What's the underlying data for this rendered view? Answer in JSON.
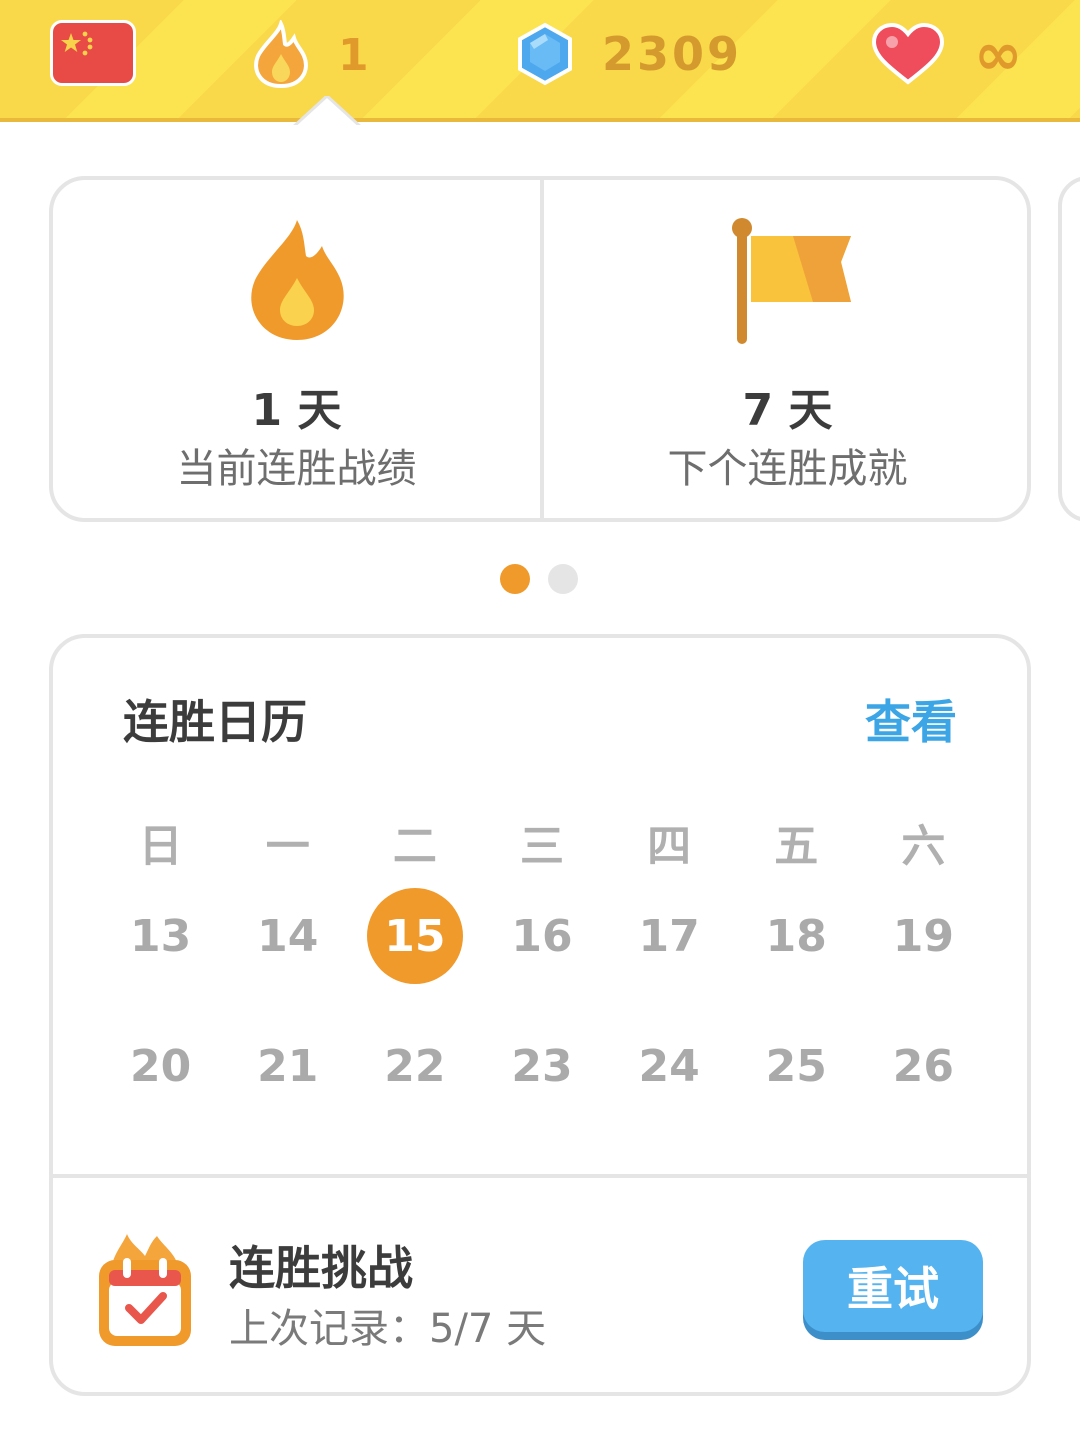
{
  "topbar": {
    "flag_label": "Chinese",
    "streak_count": "1",
    "gems": "2309",
    "hearts": "∞"
  },
  "stats": [
    {
      "icon": "fire-icon",
      "value": "1 天",
      "label": "当前连胜战绩"
    },
    {
      "icon": "flag-icon",
      "value": "7 天",
      "label": "下个连胜成就"
    }
  ],
  "carousel": {
    "page": 1,
    "pages": 2
  },
  "calendar": {
    "title": "连胜日历",
    "link": "查看",
    "weekdays": [
      "日",
      "一",
      "二",
      "三",
      "四",
      "五",
      "六"
    ],
    "week1": [
      "13",
      "14",
      "15",
      "16",
      "17",
      "18",
      "19"
    ],
    "week2": [
      "20",
      "21",
      "22",
      "23",
      "24",
      "25",
      "26"
    ],
    "today": "15"
  },
  "challenge": {
    "title": "连胜挑战",
    "subtitle": "上次记录：5/7 天",
    "button": "重试"
  },
  "colors": {
    "accent_orange": "#f09a2c",
    "link_blue": "#3ba5e6",
    "button_blue": "#55b3ef",
    "bar_yellow": "#f9d84a"
  }
}
